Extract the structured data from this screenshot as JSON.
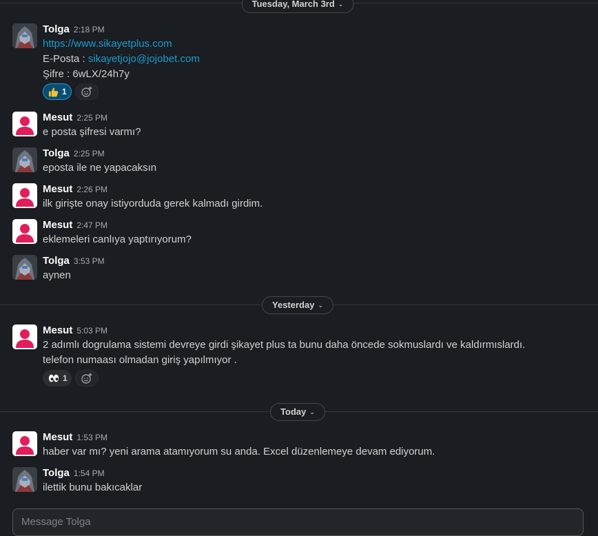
{
  "dividers": [
    {
      "label": "Tuesday, March 3rd"
    },
    {
      "label": "Yesterday"
    },
    {
      "label": "Today"
    }
  ],
  "messages": [
    {
      "author": "Tolga",
      "time": "2:18 PM",
      "lines": [
        "https://www.sikayetplus.com",
        "E-Posta : ",
        "sikayetjojo@jojobet.com",
        "Şifre : 6wLX/24h7y"
      ],
      "reactions": [
        {
          "emoji": "thumbs-up",
          "count": "1"
        }
      ]
    },
    {
      "author": "Mesut",
      "time": "2:25 PM",
      "lines": [
        "e posta şifresi varmı?"
      ]
    },
    {
      "author": "Tolga",
      "time": "2:25 PM",
      "lines": [
        "eposta ile ne yapacaksın"
      ]
    },
    {
      "author": "Mesut",
      "time": "2:26 PM",
      "lines": [
        "ilk girişte onay istiyorduda gerek kalmadı girdim."
      ]
    },
    {
      "author": "Mesut",
      "time": "2:47 PM",
      "lines": [
        "eklemeleri canlıya yaptırıyorum?"
      ]
    },
    {
      "author": "Tolga",
      "time": "3:53 PM",
      "lines": [
        "aynen"
      ]
    },
    {
      "author": "Mesut",
      "time": "5:03 PM",
      "lines": [
        "2 adımlı dogrulama sistemi devreye girdi şikayet plus ta bunu daha öncede sokmuslardı ve kaldırmıslardı.",
        "telefon numaası olmadan giriş yapılmıyor ."
      ],
      "reactions": [
        {
          "emoji": "eyes",
          "count": "1"
        }
      ]
    },
    {
      "author": "Mesut",
      "time": "1:53 PM",
      "lines": [
        "haber var mı? yeni arama atamıyorum su anda. Excel düzenlemeye devam ediyorum."
      ]
    },
    {
      "author": "Tolga",
      "time": "1:54 PM",
      "lines": [
        "ilettik bunu bakıcaklar"
      ]
    }
  ],
  "composer": {
    "placeholder": "Message Tolga"
  },
  "colors": {
    "background": "#1a1d21",
    "link": "#1d9bd1",
    "active_reaction": "#0b4c73",
    "avatar_mesut": "#e01e5a"
  }
}
